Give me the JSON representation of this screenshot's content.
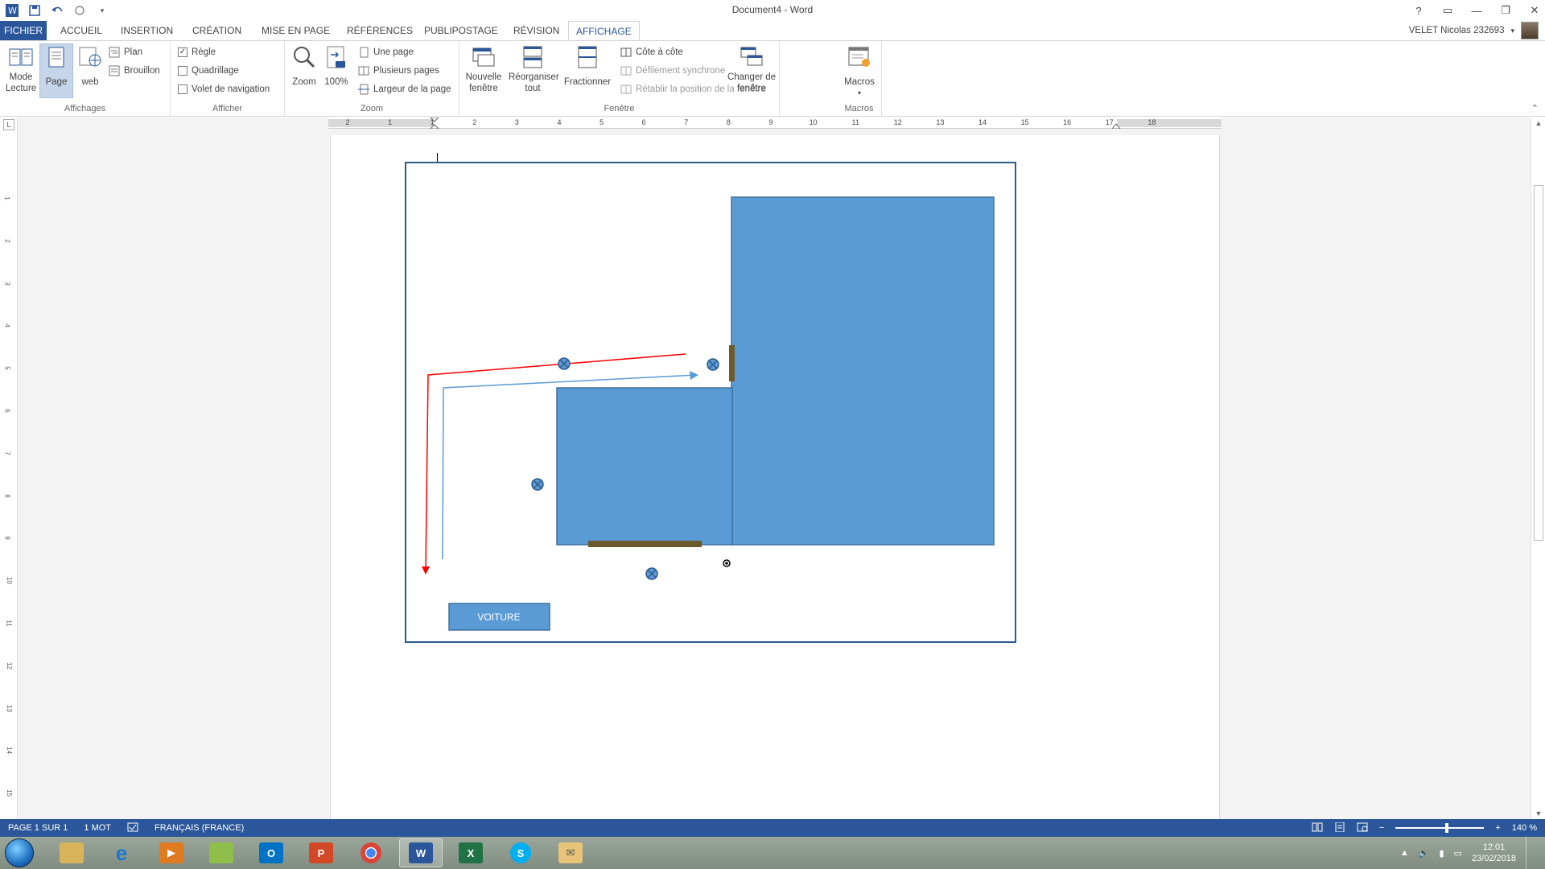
{
  "window": {
    "title": "Document4 - Word"
  },
  "title_controls": {
    "help": "?",
    "ribbon_display": "▭",
    "minimize": "—",
    "restore": "❐",
    "close": "✕"
  },
  "tabs": [
    {
      "label": "FICHIER"
    },
    {
      "label": "ACCUEIL"
    },
    {
      "label": "INSERTION"
    },
    {
      "label": "CRÉATION"
    },
    {
      "label": "MISE EN PAGE"
    },
    {
      "label": "RÉFÉRENCES"
    },
    {
      "label": "PUBLIPOSTAGE"
    },
    {
      "label": "RÉVISION"
    },
    {
      "label": "AFFICHAGE"
    }
  ],
  "user": {
    "name": "VELET Nicolas 232693"
  },
  "ribbon": {
    "affichages": {
      "label": "Affichages",
      "mode_lecture": "Mode Lecture",
      "page": "Page",
      "web": "web",
      "plan": "Plan",
      "brouillon": "Brouillon"
    },
    "afficher": {
      "label": "Afficher",
      "regle": "Règle",
      "quadrillage": "Quadrillage",
      "volet": "Volet de navigation",
      "regle_checked": "✓"
    },
    "zoom": {
      "label": "Zoom",
      "zoom": "Zoom",
      "pct100": "100%",
      "une_page": "Une page",
      "plusieurs_pages": "Plusieurs pages",
      "largeur_page": "Largeur de la page"
    },
    "fenetre": {
      "label": "Fenêtre",
      "nouvelle": "Nouvelle fenêtre",
      "reorganiser": "Réorganiser tout",
      "fractionner": "Fractionner",
      "cote_a_cote": "Côte à côte",
      "defilement": "Défilement synchrone",
      "retablir": "Rétablir la position de la fenêtre",
      "changer": "Changer de fenêtre"
    },
    "macros": {
      "label": "Macros",
      "macros": "Macros"
    }
  },
  "ruler": {
    "h_ticks": [
      "2",
      "1",
      "1",
      "2",
      "3",
      "4",
      "5",
      "6",
      "7",
      "8",
      "9",
      "10",
      "11",
      "12",
      "13",
      "14",
      "15",
      "16",
      "17",
      "18"
    ],
    "v_ticks": [
      "1",
      "2",
      "3",
      "4",
      "5",
      "6",
      "7",
      "8",
      "9",
      "10",
      "11",
      "12",
      "13",
      "14",
      "15"
    ],
    "corner": "L"
  },
  "drawing": {
    "car_label": "VOITURE"
  },
  "status": {
    "page": "PAGE 1 SUR 1",
    "words": "1 MOT",
    "language": "FRANÇAIS (FRANCE)",
    "zoom": "140 %"
  },
  "taskbar": {
    "apps": [
      "explorer-icon",
      "ie-icon",
      "media-icon",
      "folder-icon",
      "outlook-icon",
      "powerpoint-icon",
      "chrome-icon",
      "word-icon",
      "excel-icon",
      "skype-icon",
      "mail-icon"
    ],
    "time": "12:01",
    "date": "23/02/2018"
  },
  "colors": {
    "accent": "#2b579a",
    "shape_fill": "#5b9bd5",
    "shape_border": "#41719c",
    "door": "#6b5a2a",
    "red_arrow": "#ff0000",
    "blue_arrow": "#5b9bd5"
  }
}
